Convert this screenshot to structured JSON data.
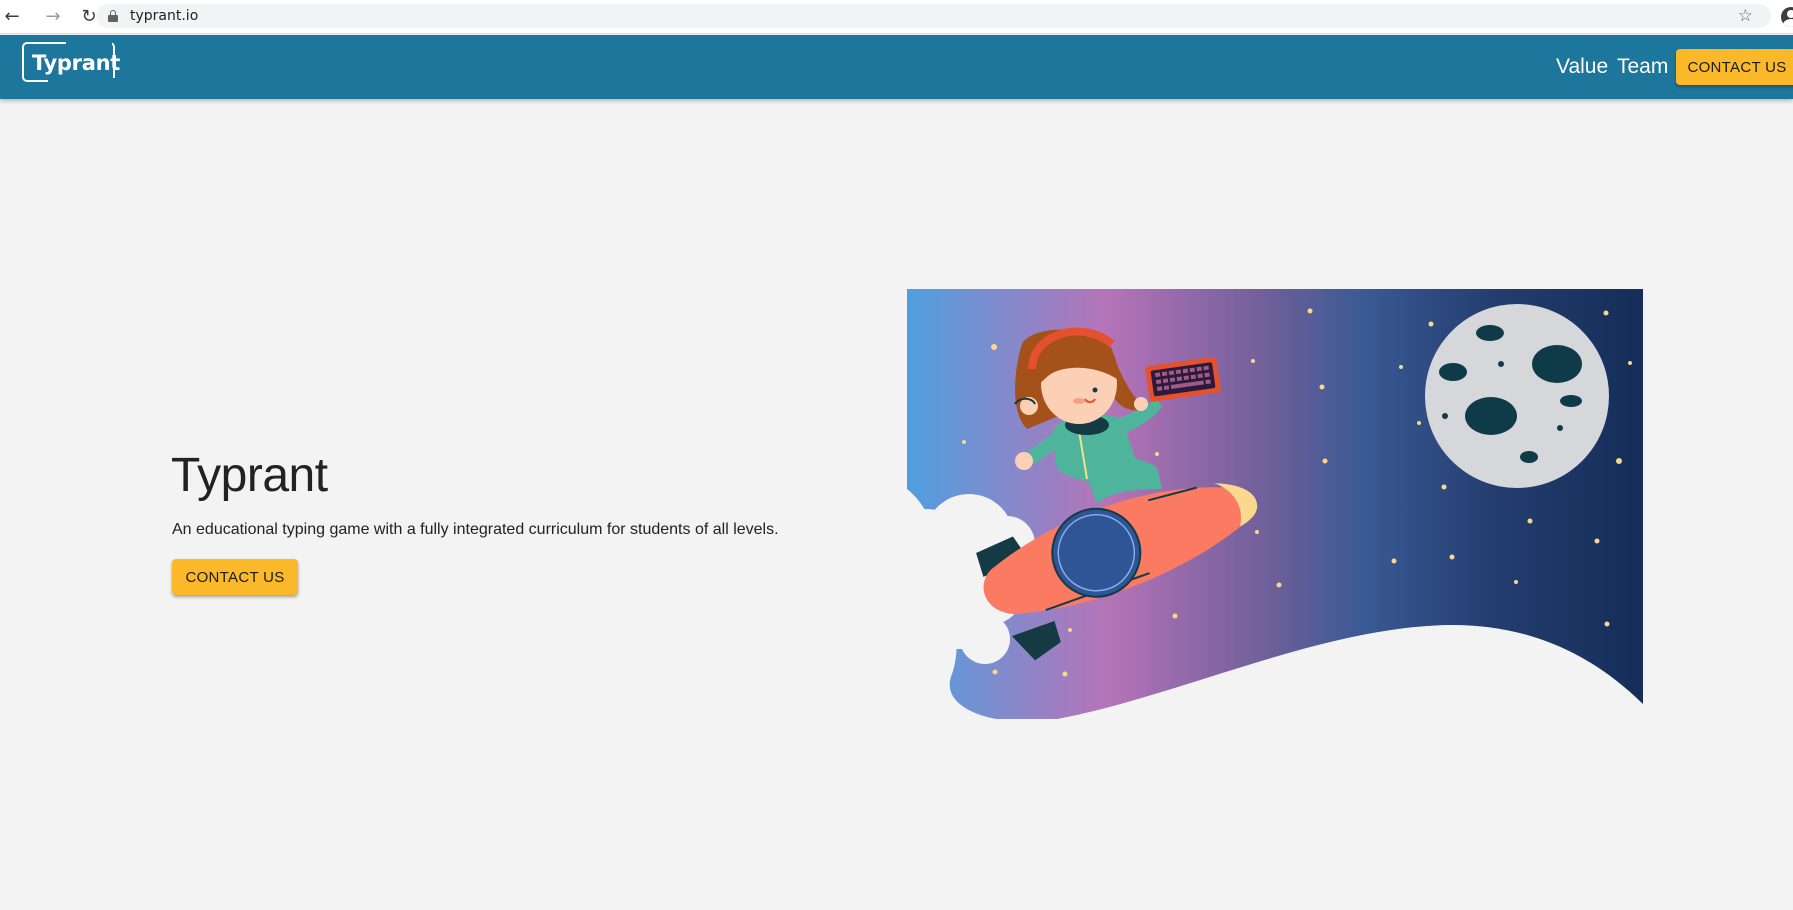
{
  "browser": {
    "url": "typrant.io",
    "back_icon": "arrow-left-icon",
    "forward_icon": "arrow-right-icon",
    "reload_icon": "reload-icon",
    "lock_icon": "lock-icon",
    "bookmark_icon": "star-icon",
    "profile_icon": "profile-icon"
  },
  "header": {
    "logo_text": "Typrant",
    "nav": [
      {
        "label": "Value"
      },
      {
        "label": "Team"
      }
    ],
    "cta_label": "CONTACT US",
    "background_color": "#1d769b",
    "cta_color": "#fbb829"
  },
  "hero": {
    "title": "Typrant",
    "subtitle": "An educational typing game with a fully integrated curriculum for students of all levels.",
    "cta_label": "CONTACT US"
  },
  "illustration": {
    "description_icon": "girl-on-rocket-with-keyboard-illustration",
    "moon_icon": "moon-icon"
  }
}
